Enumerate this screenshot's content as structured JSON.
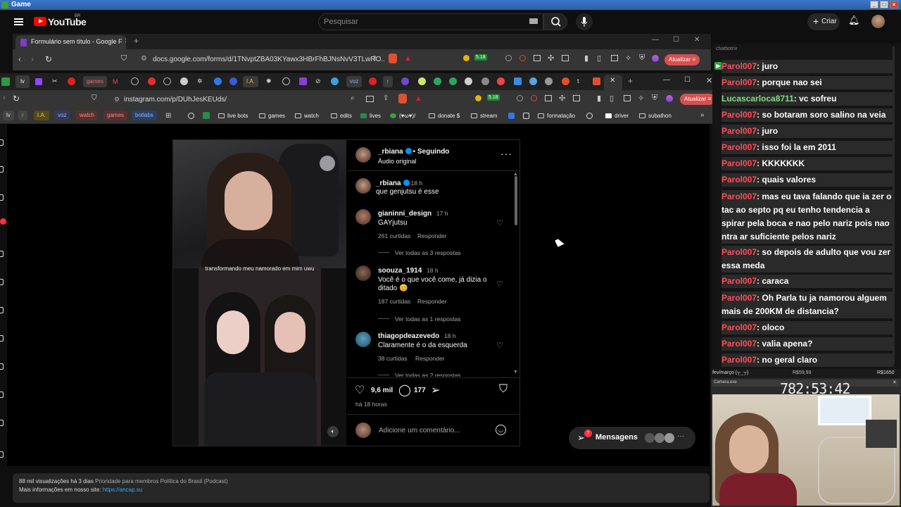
{
  "window": {
    "title": "Game"
  },
  "youtube": {
    "brand": "YouTube",
    "region": "BR",
    "search_placeholder": "Pesquisar",
    "create_label": "Criar"
  },
  "browser1": {
    "tab_title": "Formulário sem título - Google F",
    "url": "docs.google.com/forms/d/1TNvptZBA03KYawx3HBrFhBJNsNvV3TLwRO...",
    "ext_count": "5.18",
    "update_label": "Atualizar"
  },
  "browser2": {
    "tabs": [
      "lv",
      "games",
      "I.A.",
      "voz",
      "r"
    ],
    "url": "instagram.com/p/DUhJesKEUds/",
    "ext_count": "5.18",
    "update_label": "Atualizar",
    "chips": [
      "lv",
      "r",
      "I.A.",
      "voz",
      "watch",
      "games",
      "botlabs"
    ],
    "bookmarks": [
      "live bots",
      "games",
      "watch",
      "edits",
      "lives",
      "(♥ω♥)/",
      "donate $",
      "stream",
      "formatação",
      "driver",
      "subathon"
    ]
  },
  "post": {
    "author": "_rbiana",
    "follow_status": "Seguindo",
    "audio": "Áudio original",
    "video_caption": "transformando meu namorado em mim uwu",
    "comments": [
      {
        "user": "_rbiana",
        "verified": true,
        "time": "18 h",
        "text": "que genjutsu é esse",
        "likes": "",
        "reply_label": "",
        "replies": ""
      },
      {
        "user": "gianinni_design",
        "verified": false,
        "time": "17 h",
        "text": "GAYjutsu",
        "likes": "261 curtidas",
        "reply_label": "Responder",
        "replies": "Ver todas as 3 respostas"
      },
      {
        "user": "soouza_1914",
        "verified": false,
        "time": "18 h",
        "text": "Você é o que você come, já dizia o ditado 😊",
        "likes": "187 curtidas",
        "reply_label": "Responder",
        "replies": "Ver todas as 1 respostas"
      },
      {
        "user": "thiagopdeazevedo",
        "verified": false,
        "time": "18 h",
        "text": "Claramente é o da esquerda",
        "likes": "38 curtidas",
        "reply_label": "Responder",
        "replies": "Ver todas as 2 respostas"
      }
    ],
    "like_count": "9,6 mil",
    "comment_count": "177",
    "posted": "há 18 horas",
    "comment_placeholder": "Adicione um comentário...",
    "messages_label": "Mensagens",
    "messages_badge": "7"
  },
  "footer": {
    "stats": "88 mil visualizações  há 3 dias",
    "tags": "Prioridade para membros  Política do Brasil (Podcast)",
    "more_info": "Mais informações em nosso site:",
    "link": "https://ancap.su"
  },
  "chat": {
    "label": "chatbotrix",
    "messages": [
      {
        "user": "Parol007",
        "text": ": juro"
      },
      {
        "user": "Parol007",
        "text": ": porque nao sei"
      },
      {
        "user": "Lucascarloca8711",
        "text": ": vc sofreu"
      },
      {
        "user": "Parol007",
        "text": ": so botaram soro salino na veia"
      },
      {
        "user": "Parol007",
        "text": ": juro"
      },
      {
        "user": "Parol007",
        "text": ": isso foi la em 2011"
      },
      {
        "user": "Parol007",
        "text": ": KKKKKKK"
      },
      {
        "user": "Parol007",
        "text": ": quais valores"
      },
      {
        "user": "Parol007",
        "text": ": mas eu tava falando que ia zer o tac ao septo pq eu tenho tendencia a spirar pela boca e nao pelo nariz pois nao ntra ar suficiente pelos nariz"
      },
      {
        "user": "Parol007",
        "text": ": so depois de adulto que vou zer essa meda"
      },
      {
        "user": "Parol007",
        "text": ": caraca"
      },
      {
        "user": "Parol007",
        "text": ": Oh Parla tu ja namorou alguem mais de 200KM de distancia?"
      },
      {
        "user": "Parol007",
        "text": ": oloco"
      },
      {
        "user": "Parol007",
        "text": ": valia apena?"
      },
      {
        "user": "Parol007",
        "text": ": no geral claro"
      }
    ],
    "user_colors": {
      "Parol007": "#ff4d5a",
      "Lucascarloca8711": "#7fe07f"
    }
  },
  "webcam": {
    "goal_left": "fev/março (┬_┬)",
    "goal_mid": "R$59,99",
    "goal_right": "R$1650",
    "window_label": "Camera.exe",
    "timer": "782:53:42"
  }
}
